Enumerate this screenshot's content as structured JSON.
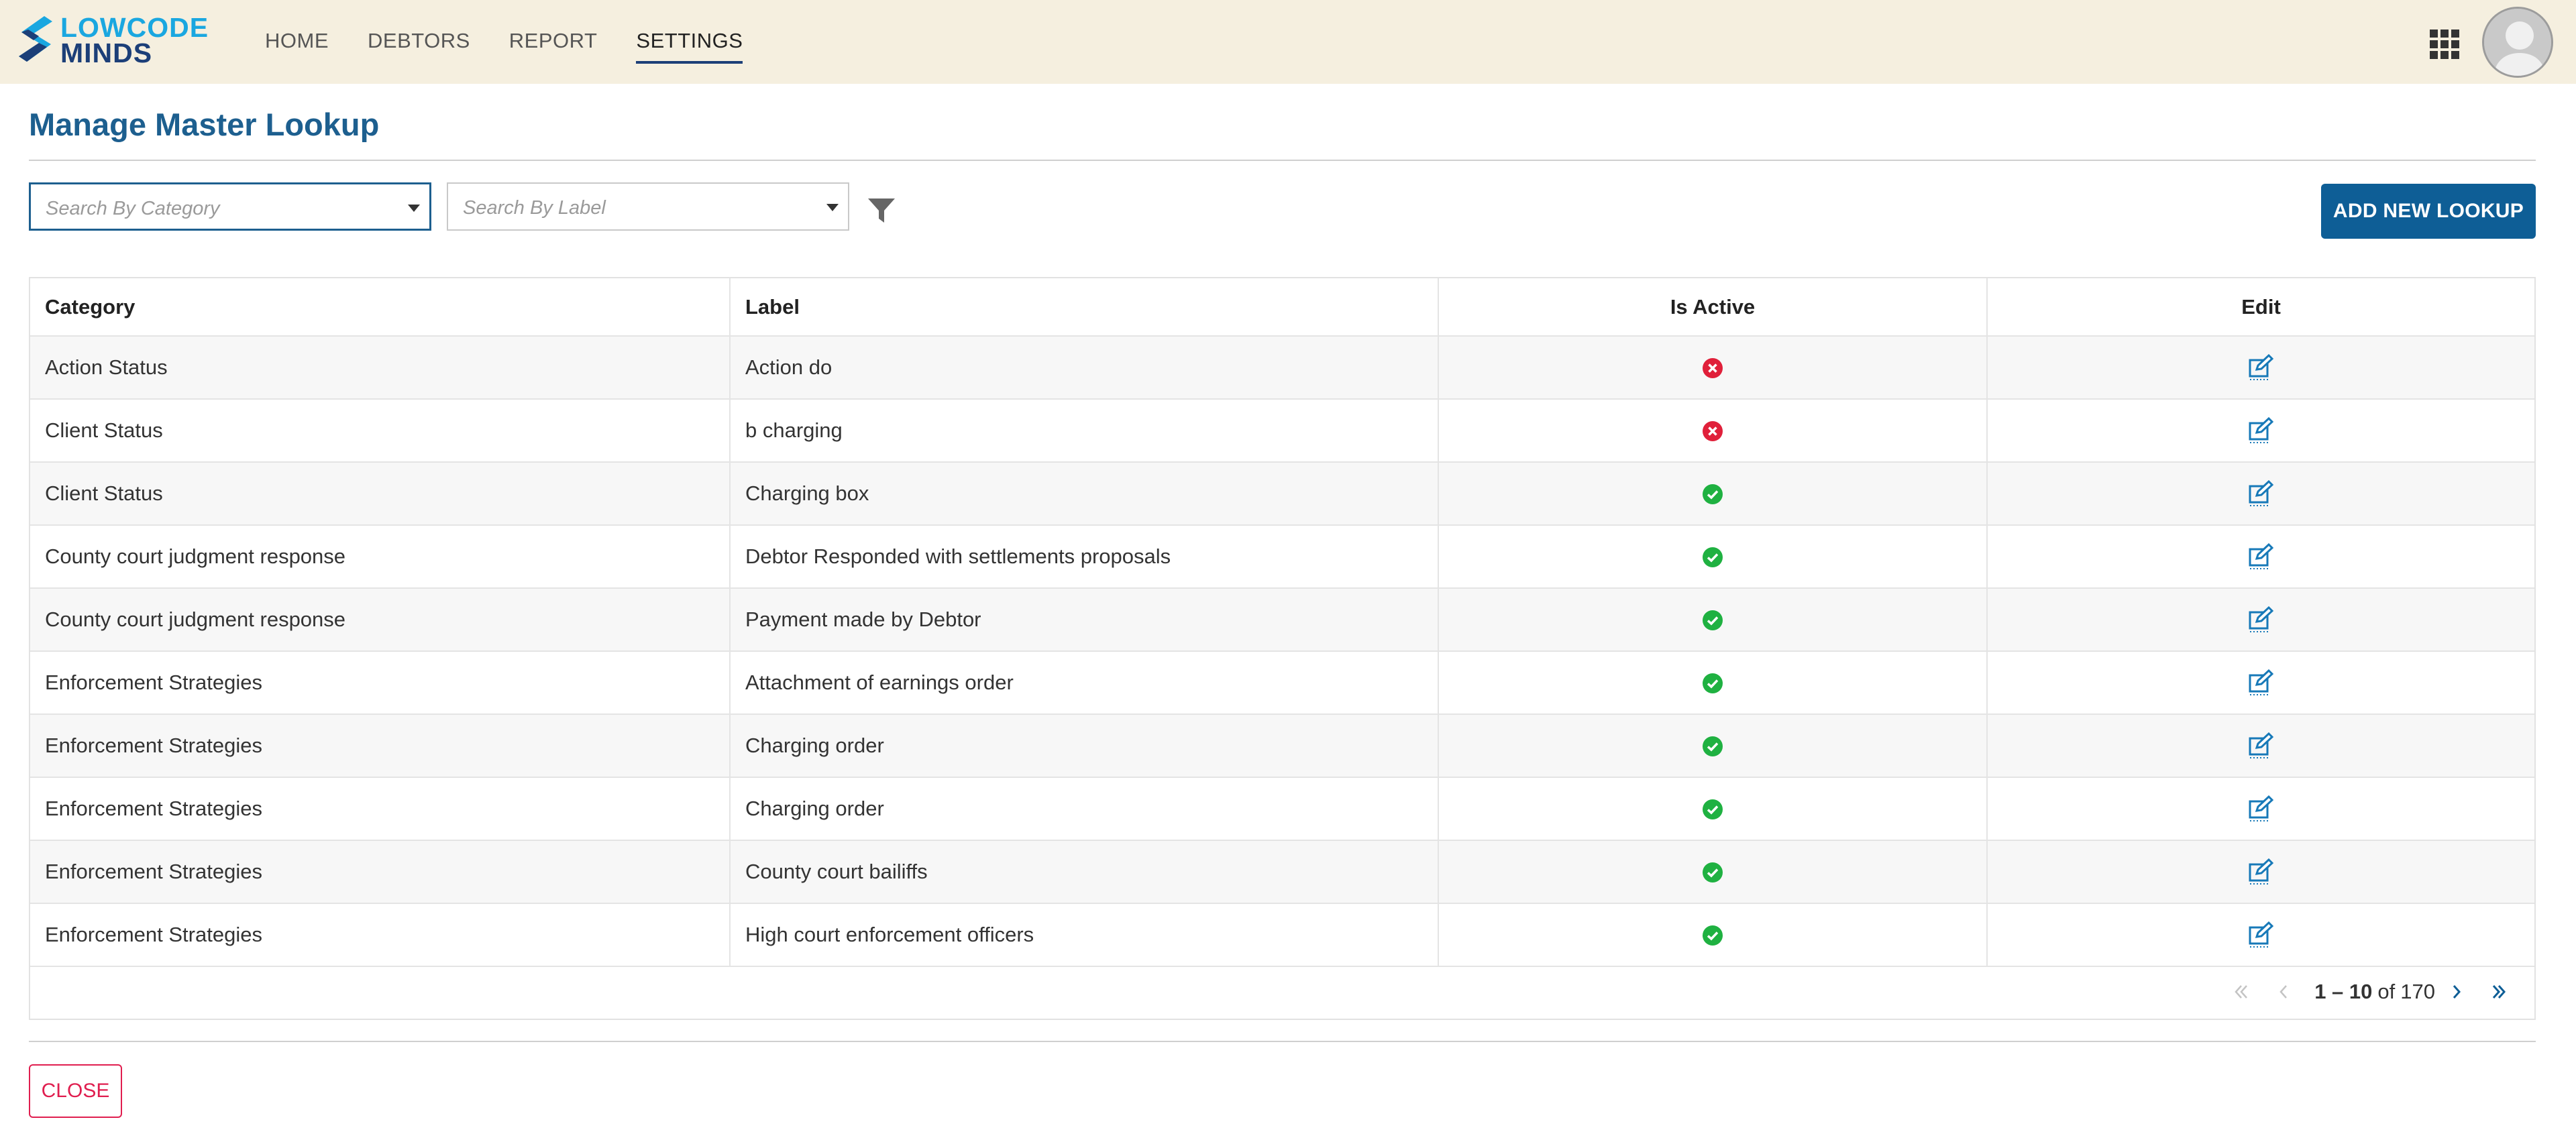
{
  "app": {
    "logo_line1": "LOWCODE",
    "logo_line2": "MINDS"
  },
  "nav": {
    "items": [
      {
        "label": "HOME",
        "active": false
      },
      {
        "label": "DEBTORS",
        "active": false
      },
      {
        "label": "REPORT",
        "active": false
      },
      {
        "label": "SETTINGS",
        "active": true
      }
    ]
  },
  "page": {
    "title": "Manage Master Lookup"
  },
  "filters": {
    "category_placeholder": "Search By Category",
    "label_placeholder": "Search By Label",
    "add_button": "ADD NEW LOOKUP"
  },
  "table": {
    "columns": [
      "Category",
      "Label",
      "Is Active",
      "Edit"
    ],
    "rows": [
      {
        "category": "Action Status",
        "label": "Action do",
        "active": false
      },
      {
        "category": "Client Status",
        "label": "b charging",
        "active": false
      },
      {
        "category": "Client Status",
        "label": "Charging box",
        "active": true
      },
      {
        "category": "County court judgment response",
        "label": "Debtor Responded with settlements proposals",
        "active": true
      },
      {
        "category": "County court judgment response",
        "label": "Payment made by Debtor",
        "active": true
      },
      {
        "category": "Enforcement Strategies",
        "label": "Attachment of earnings order",
        "active": true
      },
      {
        "category": "Enforcement Strategies",
        "label": "Charging order",
        "active": true
      },
      {
        "category": "Enforcement Strategies",
        "label": "Charging order",
        "active": true
      },
      {
        "category": "Enforcement Strategies",
        "label": "County court bailiffs",
        "active": true
      },
      {
        "category": "Enforcement Strategies",
        "label": "High court enforcement officers",
        "active": true
      }
    ]
  },
  "pagination": {
    "range": "1 – 10",
    "of_label": "of",
    "total": "170"
  },
  "footer": {
    "close_button": "CLOSE"
  },
  "colors": {
    "header_bg": "#f5efdf",
    "primary": "#0e5e96",
    "title": "#1d5f8f",
    "active_green": "#1fb141",
    "inactive_red": "#e0203a",
    "close_red": "#e01e4f"
  }
}
